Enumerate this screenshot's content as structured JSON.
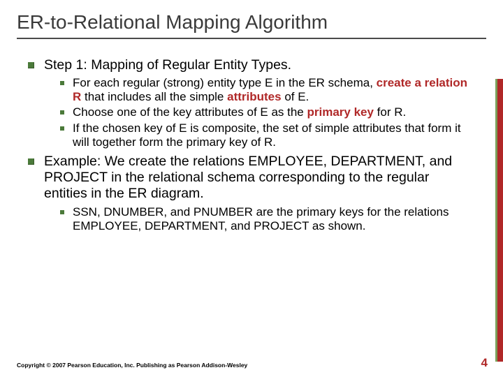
{
  "title": "ER-to-Relational Mapping Algorithm",
  "step1": {
    "heading": "Step 1: Mapping of Regular Entity Types.",
    "b1_pre": "For each regular (strong) entity type E in the ER schema, ",
    "b1_em1": "create a relation R",
    "b1_mid": " that includes all the simple ",
    "b1_em2": "attributes",
    "b1_post": " of E.",
    "b2_pre": "Choose one of the key attributes of E as the ",
    "b2_em": "primary key",
    "b2_post": " for R.",
    "b3": "If the chosen key of E is composite, the set of simple attributes that form it will together form the primary key of R."
  },
  "example": {
    "heading": "Example: We create the relations EMPLOYEE, DEPARTMENT, and PROJECT in the relational schema corresponding to the regular entities in the ER diagram.",
    "b1": "SSN, DNUMBER, and PNUMBER are the primary keys for the relations EMPLOYEE, DEPARTMENT, and PROJECT as shown."
  },
  "footer": "Copyright © 2007 Pearson Education, Inc. Publishing as Pearson Addison-Wesley",
  "page": "4"
}
